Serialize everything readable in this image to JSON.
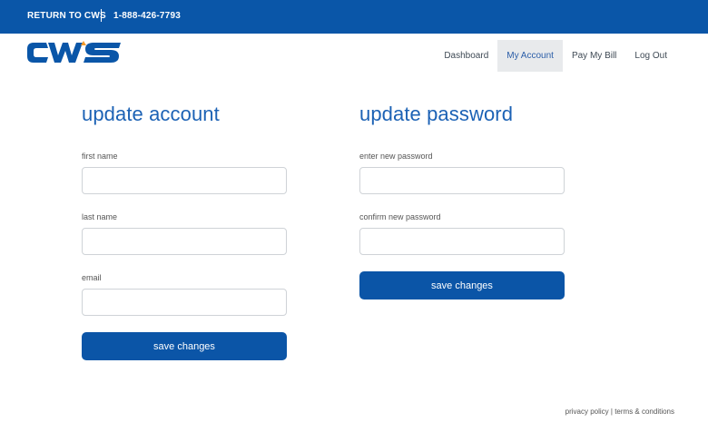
{
  "topbar": {
    "return_label": "RETURN TO CWS",
    "phone": "1-888-426-7793"
  },
  "logo": {
    "text": "CWS",
    "color": "#0a56a8"
  },
  "nav": {
    "items": [
      {
        "label": "Dashboard"
      },
      {
        "label": "My Account",
        "active": true
      },
      {
        "label": "Pay My Bill"
      },
      {
        "label": "Log Out"
      }
    ]
  },
  "account": {
    "title": "update account",
    "first_name_label": "first name",
    "first_name_value": "",
    "last_name_label": "last name",
    "last_name_value": "",
    "email_label": "email",
    "email_value": "",
    "save_label": "save changes"
  },
  "password": {
    "title": "update password",
    "new_label": "enter new password",
    "new_value": "",
    "confirm_label": "confirm new password",
    "confirm_value": "",
    "save_label": "save changes"
  },
  "footer": {
    "privacy": "privacy policy",
    "separator": "|",
    "terms": "terms & conditions"
  },
  "colors": {
    "brand_blue": "#0a56a8",
    "heading_blue": "#1c62b5",
    "active_nav_bg": "#e8eaec"
  }
}
